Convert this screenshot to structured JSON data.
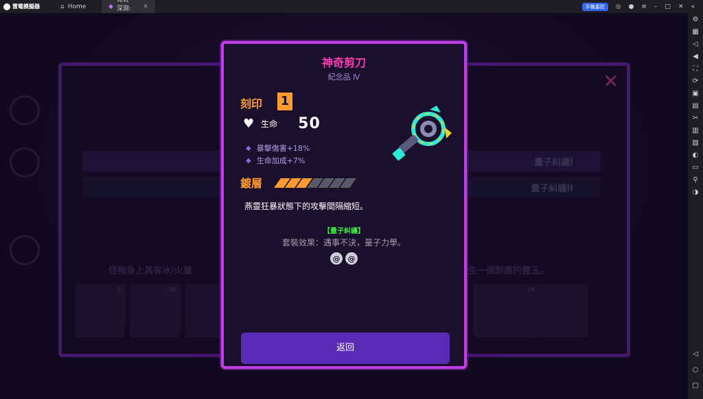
{
  "titlebar": {
    "app_name": "雷電模擬器",
    "tabs": [
      {
        "label": "Home",
        "icon": "home-icon"
      },
      {
        "label": "霓虹深淵: ...",
        "icon": "game-icon"
      }
    ],
    "remote_label": "手機遙控"
  },
  "modal": {
    "title": "神奇剪刀",
    "subtitle": "紀念品 Ⅳ",
    "engrave_label": "刻印",
    "engrave_level": "1",
    "stat_label": "生命",
    "stat_value": "50",
    "bonuses": [
      "暴擊傷害+18%",
      "生命加成+7%"
    ],
    "plating_label": "鍍層",
    "plating_filled": 3,
    "plating_total": 7,
    "description": "燕靈狂暴狀態下的攻擊間隔縮短。",
    "set_name": "【量子糾纏】",
    "set_effect": "套裝效果：遇事不決，量子力學。",
    "back_label": "返回"
  },
  "background": {
    "row1_label": "量子糾纏I",
    "row2_label": "量子糾纏II",
    "banner_left": "怪物身上具有冰/火屬",
    "banner_right": "生一個對應的靈玉。",
    "card_counts": [
      "3",
      "35",
      "",
      "",
      "24",
      ""
    ]
  },
  "colors": {
    "accent_border": "#c040e8",
    "title_pink": "#ff3fb8",
    "orange": "#ff9b2f",
    "set_green": "#3fea3f",
    "button": "#5b2bb8"
  }
}
